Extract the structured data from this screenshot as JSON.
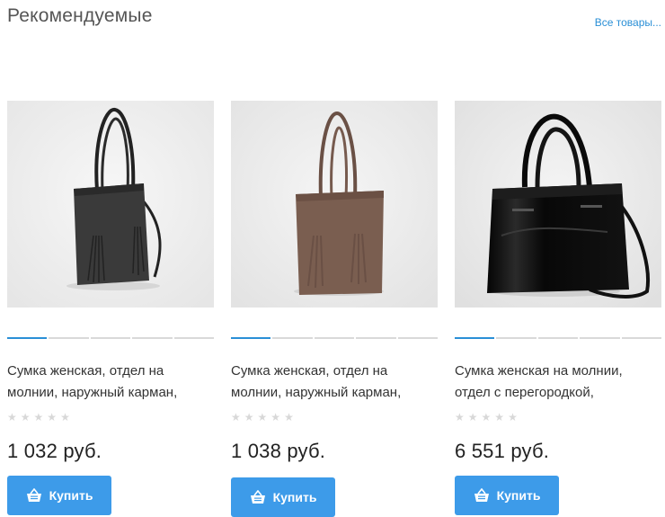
{
  "section": {
    "title": "Рекомендуемые",
    "all_link": "Все товары..."
  },
  "colors": {
    "accent": "#3d9be9",
    "link": "#2a8fd6",
    "star": "#d8d8d8"
  },
  "products": [
    {
      "name": "Сумка женская, отдел на молнии, наружный карман,",
      "price": "1 032 руб.",
      "rating_stars": 5,
      "rating": 0,
      "buy_label": "Купить",
      "bag_color": "#3a3a3a",
      "image_icon": "black-leather-tote-bag-image"
    },
    {
      "name": "Сумка женская, отдел на молнии, наружный карман,",
      "price": "1 038 руб.",
      "rating_stars": 5,
      "rating": 0,
      "buy_label": "Купить",
      "bag_color": "#7a5e50",
      "image_icon": "brown-suede-tote-bag-image"
    },
    {
      "name": "Сумка женская на молнии, отдел с перегородкой,",
      "price": "6 551 руб.",
      "rating_stars": 5,
      "rating": 0,
      "buy_label": "Купить",
      "bag_color": "#0d0d0d",
      "image_icon": "black-patent-handbag-image"
    }
  ]
}
